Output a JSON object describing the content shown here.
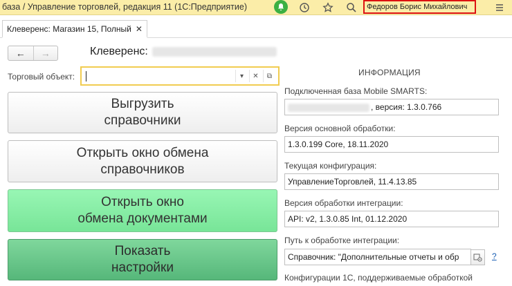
{
  "titlebar": {
    "title": "база / Управление торговлей, редакция 11  (1С:Предприятие)",
    "user": "Федоров Борис Михайлович",
    "icons": [
      "notification-bell-icon",
      "history-icon",
      "star-icon",
      "search-icon",
      "menu-icon"
    ]
  },
  "tab": {
    "label": "Клеверенс: Магазин 15, Полный",
    "close": "✕"
  },
  "nav": {
    "back": "←",
    "forward": "→"
  },
  "form": {
    "title": "Клеверенс:"
  },
  "trade_object": {
    "label": "Торговый объект:",
    "value": "",
    "dropdown": "▾",
    "clear": "✕",
    "open": "⧉"
  },
  "buttons": {
    "upload_line1": "Выгрузить",
    "upload_line2": "справочники",
    "exchange_refs_line1": "Открыть окно обмена",
    "exchange_refs_line2": "справочников",
    "exchange_docs_line1": "Открыть окно",
    "exchange_docs_line2": "обмена документами",
    "settings_line1": "Показать",
    "settings_line2": "настройки"
  },
  "info": {
    "heading": "ИНФОРМАЦИЯ",
    "db_label": "Подключенная база Mobile SMARTS:",
    "db_value": ", версия: 1.3.0.766",
    "base_ver_label": "Версия основной обработки:",
    "base_ver_value": "1.3.0.199 Core, 18.11.2020",
    "config_label": "Текущая конфигурация:",
    "config_value": "УправлениеТорговлей, 11.4.13.85",
    "integ_ver_label": "Версия обработки интеграции:",
    "integ_ver_value": "API: v2, 1.3.0.85 Int, 01.12.2020",
    "path_label": "Путь к обработке интеграции:",
    "path_value": "Справочник: \"Дополнительные отчеты и обр",
    "help": "?",
    "configs_label": "Конфигурации 1С, поддерживаемые обработкой"
  }
}
